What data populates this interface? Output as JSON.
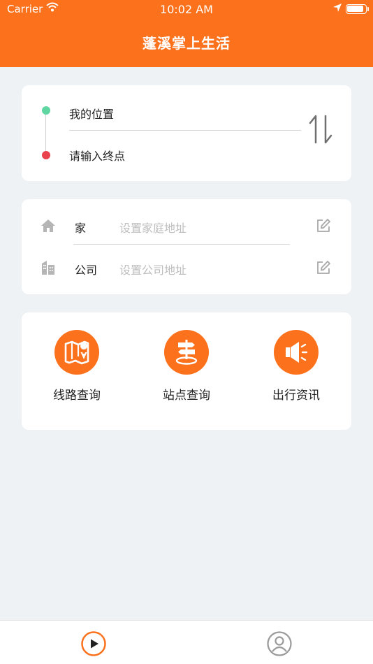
{
  "status_bar": {
    "carrier": "Carrier",
    "time": "10:02 AM"
  },
  "header": {
    "title": "蓬溪掌上生活",
    "background": "#fb711c"
  },
  "route": {
    "start": "我的位置",
    "end": "请输入终点",
    "swap_icon": "swap-arrows-icon"
  },
  "addresses": {
    "home": {
      "label": "家",
      "placeholder": "设置家庭地址",
      "icon": "home-icon"
    },
    "company": {
      "label": "公司",
      "placeholder": "设置公司地址",
      "icon": "building-icon"
    }
  },
  "functions": [
    {
      "label": "线路查询",
      "icon": "map-icon"
    },
    {
      "label": "站点查询",
      "icon": "signpost-icon"
    },
    {
      "label": "出行资讯",
      "icon": "megaphone-icon"
    }
  ],
  "tabbar": {
    "items": [
      {
        "icon": "play-circle-icon",
        "active": true
      },
      {
        "icon": "user-circle-icon",
        "active": false
      }
    ]
  },
  "colors": {
    "accent": "#fb711c",
    "start_dot": "#5fd6a1",
    "end_dot": "#e8434d"
  }
}
